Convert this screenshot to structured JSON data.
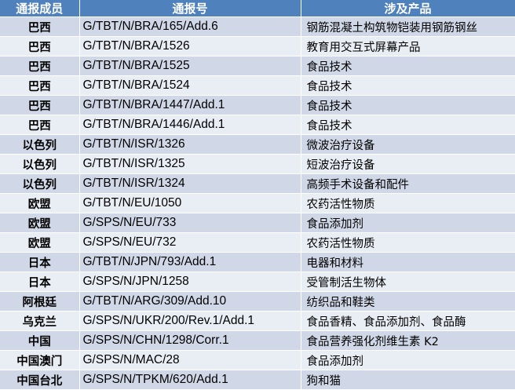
{
  "header": {
    "member": "通报成员",
    "code": "通报号",
    "product": "涉及产品"
  },
  "rows": [
    {
      "member": "巴西",
      "code": "G/TBT/N/BRA/165/Add.6",
      "product": "钢筋混凝土构筑物铠装用钢筋钢丝"
    },
    {
      "member": "巴西",
      "code": "G/TBT/N/BRA/1526",
      "product": "教育用交互式屏幕产品"
    },
    {
      "member": "巴西",
      "code": "G/TBT/N/BRA/1525",
      "product": "食品技术"
    },
    {
      "member": "巴西",
      "code": "G/TBT/N/BRA/1524",
      "product": "食品技术"
    },
    {
      "member": "巴西",
      "code": "G/TBT/N/BRA/1447/Add.1",
      "product": "食品技术"
    },
    {
      "member": "巴西",
      "code": "G/TBT/N/BRA/1446/Add.1",
      "product": "食品技术"
    },
    {
      "member": "以色列",
      "code": "G/TBT/N/ISR/1326",
      "product": "微波治疗设备"
    },
    {
      "member": "以色列",
      "code": "G/TBT/N/ISR/1325",
      "product": "短波治疗设备"
    },
    {
      "member": "以色列",
      "code": "G/TBT/N/ISR/1324",
      "product": "高频手术设备和配件"
    },
    {
      "member": "欧盟",
      "code": "G/TBT/N/EU/1050",
      "product": "农药活性物质"
    },
    {
      "member": "欧盟",
      "code": "G/SPS/N/EU/733",
      "product": "食品添加剂"
    },
    {
      "member": "欧盟",
      "code": "G/SPS/N/EU/732",
      "product": "农药活性物质"
    },
    {
      "member": "日本",
      "code": "G/TBT/N/JPN/793/Add.1",
      "product": "电器和材料"
    },
    {
      "member": "日本",
      "code": "G/SPS/N/JPN/1258",
      "product": "受管制活生物体"
    },
    {
      "member": "阿根廷",
      "code": "G/TBT/N/ARG/309/Add.10",
      "product": "纺织品和鞋类"
    },
    {
      "member": "乌克兰",
      "code": "G/SPS/N/UKR/200/Rev.1/Add.1",
      "product": "食品香精、食品添加剂、食品酶"
    },
    {
      "member": "中国",
      "code": "G/SPS/N/CHN/1298/Corr.1",
      "product": "食品营养强化剂维生素 K2"
    },
    {
      "member": "中国澳门",
      "code": "G/SPS/N/MAC/28",
      "product": "食品添加剂"
    },
    {
      "member": "中国台北",
      "code": "G/SPS/N/TPKM/620/Add.1",
      "product": "狗和猫"
    }
  ],
  "colors": {
    "header_bg": "#4F81BD",
    "row_odd_bg": "#D0D8E8",
    "row_even_bg": "#E9EDF4"
  }
}
